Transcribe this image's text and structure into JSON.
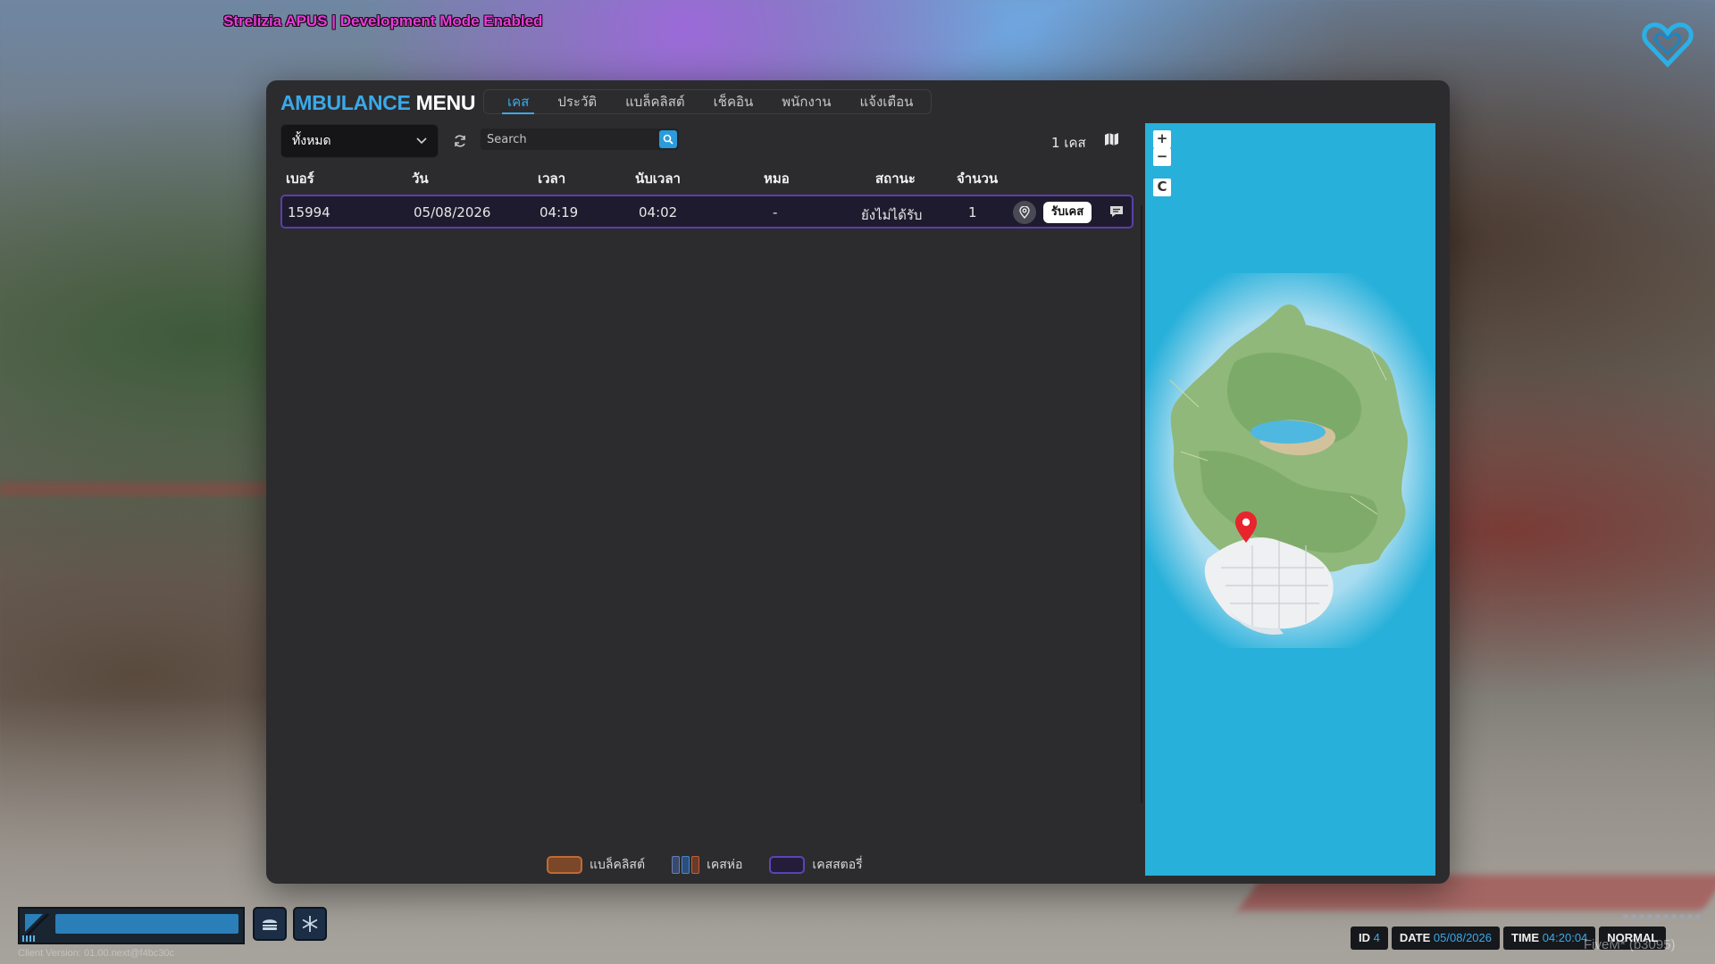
{
  "banner": "Strelizia APUS | Development Mode Enabled",
  "brand": {
    "part1": "AMBULANCE",
    "part2": "MENU"
  },
  "tabs": [
    {
      "label": "เคส",
      "active": true
    },
    {
      "label": "ประวัติ",
      "active": false
    },
    {
      "label": "แบล็คลิสต์",
      "active": false
    },
    {
      "label": "เช็คอิน",
      "active": false
    },
    {
      "label": "พนักงาน",
      "active": false
    },
    {
      "label": "แจ้งเตือน",
      "active": false
    }
  ],
  "toolbar": {
    "filter_value": "ทั้งหมด",
    "search_placeholder": "Search",
    "case_count": "1 เคส"
  },
  "table": {
    "headers": [
      "เบอร์",
      "วัน",
      "เวลา",
      "นับเวลา",
      "หมอ",
      "สถานะ",
      "จำนวน"
    ],
    "rows": [
      {
        "number": "15994",
        "date": "05/08/2026",
        "time": "04:19",
        "elapsed": "04:02",
        "doctor": "-",
        "status": "ยังไม่ได้รับ",
        "count": "1",
        "accept_label": "รับเคส"
      }
    ]
  },
  "legend": {
    "blacklist": "แบล็คลิสต์",
    "stacked": "เคสห่อ",
    "story": "เคสสตอรี่"
  },
  "map": {
    "zoom_in": "+",
    "zoom_out": "−",
    "center_label": "C"
  },
  "hud": {
    "client_version": "Client Version: 01.00.next@f4bc30c",
    "id_label": "ID",
    "id_value": "4",
    "date_label": "DATE",
    "date_value": "05/08/2026",
    "time_label": "TIME",
    "time_value": "04:20:04",
    "mode": "NORMAL",
    "fivem": "FiveM* (b3095)"
  },
  "colors": {
    "accent": "#3aa9e8",
    "row_border": "#5b3fa8",
    "map_water": "#27b0da",
    "banner": "#e63bd6"
  }
}
